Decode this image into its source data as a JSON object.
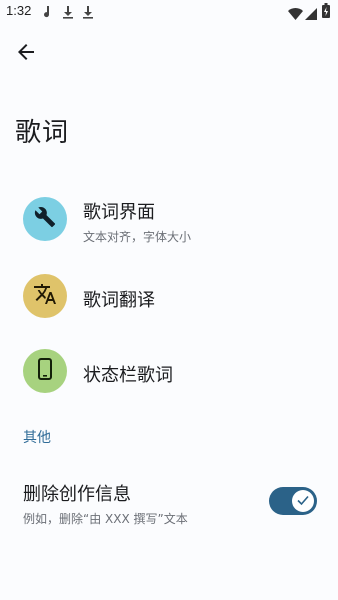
{
  "status_bar": {
    "time": "1:32"
  },
  "header": {
    "back_icon": "arrow-back-icon"
  },
  "page_title": "歌词",
  "items": [
    {
      "label": "歌词界面",
      "subtitle": "文本对齐，字体大小",
      "icon": "wrench-icon",
      "color": "#7ccfe3"
    },
    {
      "label": "歌词翻译",
      "icon": "translate-icon",
      "color": "#dfc36a"
    },
    {
      "label": "状态栏歌词",
      "icon": "phone-icon",
      "color": "#a7d27f"
    }
  ],
  "section_header": "其他",
  "toggle": {
    "label": "删除创作信息",
    "subtitle": "例如，删除“由 XXX 撰写”文本",
    "checked": true
  },
  "colors": {
    "accent": "#2f6b97",
    "switch_track": "#2b6288"
  }
}
